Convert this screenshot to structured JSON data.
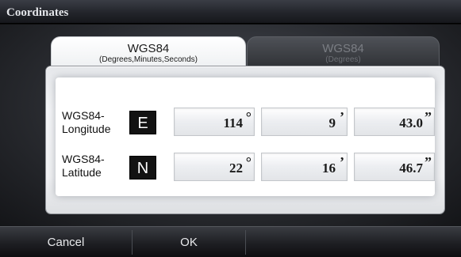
{
  "window": {
    "title": "Coordinates"
  },
  "tabs": [
    {
      "title": "WGS84",
      "subtitle": "(Degrees,Minutes,Seconds)",
      "active": true
    },
    {
      "title": "WGS84",
      "subtitle": "(Degrees)",
      "active": false
    }
  ],
  "longitude": {
    "label_line1": "WGS84-",
    "label_line2": "Longitude",
    "direction": "E",
    "degrees": "114",
    "degrees_unit": "°",
    "minutes": "9",
    "minutes_unit": "’",
    "seconds": "43.0",
    "seconds_unit": "”"
  },
  "latitude": {
    "label_line1": "WGS84-",
    "label_line2": "Latitude",
    "direction": "N",
    "degrees": "22",
    "degrees_unit": "°",
    "minutes": "16",
    "minutes_unit": "’",
    "seconds": "46.7",
    "seconds_unit": "”"
  },
  "buttons": {
    "cancel": "Cancel",
    "ok": "OK"
  }
}
